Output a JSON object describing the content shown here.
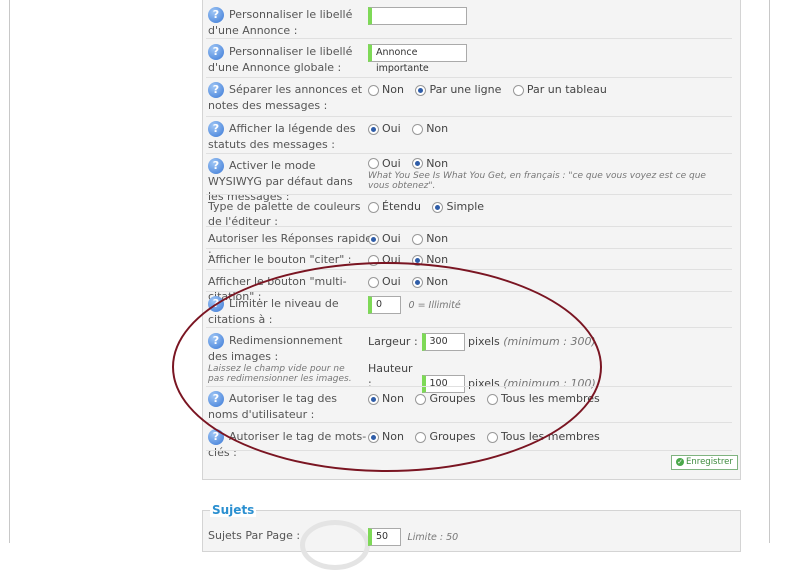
{
  "rows": {
    "annonce": {
      "label": "Personnaliser le libellé d'une Annonce :",
      "value": ""
    },
    "annonce_globale": {
      "label": "Personnaliser le libellé d'une Annonce globale :",
      "value": "Annonce importante"
    },
    "separer": {
      "label": "Séparer les annonces et notes des messages :",
      "options": [
        "Non",
        "Par une ligne",
        "Par un tableau"
      ],
      "selected": "Par une ligne"
    },
    "legende": {
      "label": "Afficher la légende des statuts des messages :",
      "options": [
        "Oui",
        "Non"
      ],
      "selected": "Oui"
    },
    "wysiwyg": {
      "label": "Activer le mode WYSIWYG par défaut dans les messages :",
      "options": [
        "Oui",
        "Non"
      ],
      "selected": "Non",
      "hint": "What You See Is What You Get, en français : \"ce que vous voyez est ce que vous obtenez\"."
    },
    "palette": {
      "label": "Type de palette de couleurs de l'éditeur :",
      "options": [
        "Étendu",
        "Simple"
      ],
      "selected": "Simple"
    },
    "reponses": {
      "label": "Autoriser les Réponses rapides :",
      "options": [
        "Oui",
        "Non"
      ],
      "selected": "Oui"
    },
    "citer": {
      "label": "Afficher le bouton \"citer\" :",
      "options": [
        "Oui",
        "Non"
      ],
      "selected": "Non"
    },
    "multi": {
      "label": "Afficher le bouton \"multi-citation\" :",
      "options": [
        "Oui",
        "Non"
      ],
      "selected": "Non"
    },
    "citations": {
      "label": "Limiter le niveau de citations à :",
      "value": "0",
      "hint": "0 = Illimité"
    },
    "redim": {
      "label": "Redimensionnement des images :",
      "note": "Laissez le champ vide pour ne pas redimensionner les images.",
      "largeur_label": "Largeur :",
      "largeur_value": "300",
      "largeur_hint": "(minimum : 300)",
      "hauteur_label": "Hauteur :",
      "hauteur_value": "100",
      "hauteur_hint": "(minimum : 100)",
      "unit": "pixels"
    },
    "tag_noms": {
      "label": "Autoriser le tag des noms d'utilisateur :",
      "options": [
        "Non",
        "Groupes",
        "Tous les membres"
      ],
      "selected": "Non"
    },
    "tag_mots": {
      "label": "Autoriser le tag de mots-clés :",
      "options": [
        "Non",
        "Groupes",
        "Tous les membres"
      ],
      "selected": "Non"
    }
  },
  "save_label": "Enregistrer",
  "sujets": {
    "title": "Sujets",
    "par_page_label": "Sujets Par Page :",
    "par_page_value": "50",
    "limite_hint": "Limite : 50"
  },
  "colors": {
    "accent": "#7ed957",
    "section_title": "#2a8fd0",
    "annotation": "#7a1522"
  }
}
